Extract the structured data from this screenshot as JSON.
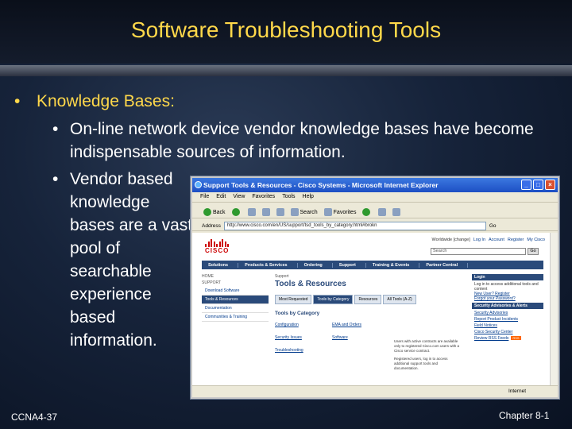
{
  "slide": {
    "title": "Software Troubleshooting Tools",
    "bullet_l1": "Knowledge Bases:",
    "bullets_l2": [
      "On-line network device vendor knowledge bases have become indispensable sources of information.",
      "Vendor based knowledge bases are a vast pool of searchable experience based information."
    ],
    "footer_left": "CCNA4-37",
    "footer_right": "Chapter 8-1"
  },
  "browser": {
    "title": "Support Tools & Resources - Cisco Systems - Microsoft Internet Explorer",
    "menu": [
      "File",
      "Edit",
      "View",
      "Favorites",
      "Tools",
      "Help"
    ],
    "toolbar": {
      "back": "Back",
      "search": "Search",
      "favorites": "Favorites"
    },
    "address_label": "Address",
    "address_value": "http://www.cisco.com/en/US/support/tsd_tools_by_category.html#brokn",
    "go": "Go",
    "status_zone": "Internet",
    "page": {
      "toplinks": [
        "Worldwide [change]",
        "Log In",
        "Account",
        "Register",
        "My Cisco"
      ],
      "search_placeholder": "Search",
      "search_go": "Go",
      "nav": [
        "Solutions",
        "Products & Services",
        "Ordering",
        "Support",
        "Training & Events",
        "Partner Central"
      ],
      "crumb": [
        "HOME",
        "SUPPORT"
      ],
      "leftnav": [
        "Download Software",
        "Tools & Resources",
        "Documentation",
        "Communities & Training"
      ],
      "support_label": "Support",
      "heading": "Tools & Resources",
      "tabs": [
        "Most Requested",
        "Tools by Category",
        "Resources",
        "All Tools (A-Z)"
      ],
      "cat_title": "Tools by Category",
      "categories": [
        "Configuration",
        "EMA and Orders",
        "Security Issues",
        "Software",
        "Troubleshooting"
      ],
      "info": [
        "Users with active contracts are available only to registered Cisco.com users with a Cisco service contract.",
        "Registered users, log in to access additional support tools and documentation."
      ],
      "right": {
        "login_head": "Login",
        "login_text": "Log in to access additional tools and content",
        "new_user": "New User? Register",
        "forgot": "Forgot your Password?",
        "security_head": "Security Advisories & Alerts",
        "links": [
          "Security Advisories",
          "Report Product Incidents",
          "Field Notices",
          "Cisco Security Center",
          "Review RSS Feeds"
        ],
        "rss": "RSS"
      }
    }
  }
}
